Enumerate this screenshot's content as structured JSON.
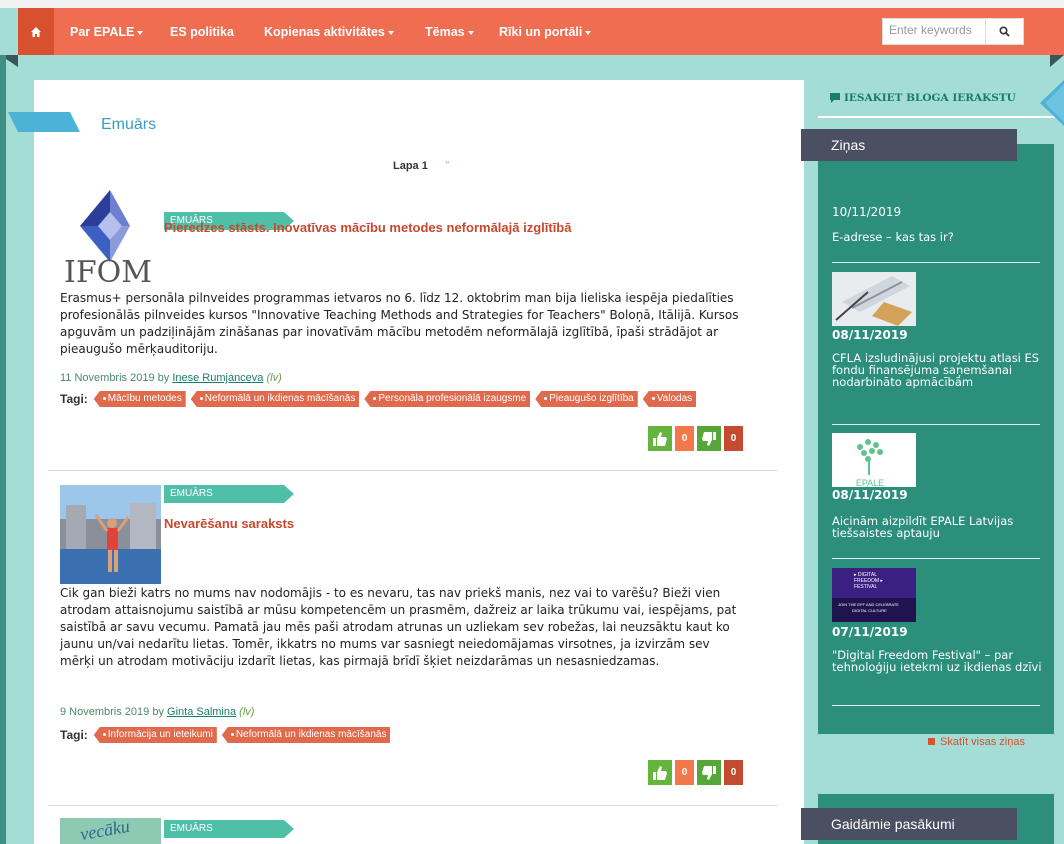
{
  "nav": {
    "items": [
      {
        "label": "Par EPALE",
        "dropdown": true
      },
      {
        "label": "ES politika",
        "dropdown": false
      },
      {
        "label": "Kopienas aktivitātes",
        "dropdown": true
      },
      {
        "label": "Tēmas",
        "dropdown": true
      },
      {
        "label": "Rīki un portāli",
        "dropdown": true
      }
    ],
    "search_placeholder": "Enter keywords"
  },
  "colors": {
    "nav": "#ef6d51",
    "accent_teal": "#2b8f7c",
    "title_red": "#c9482e",
    "background": "#a3ddd6"
  },
  "page": {
    "section_title": "Emuārs",
    "pager_label": "Lapa 1",
    "pager_arrow": "\""
  },
  "posts": [
    {
      "category": "EMUĀRS",
      "title": "Pieredzes stāsts. Inovatīvas mācību metodes neformālajā izglītībā",
      "logo_text": "IFOM",
      "excerpt": "Erasmus+ personāla pilnveides programmas ietvaros no 6. līdz 12. oktobrim man bija lieliska iespēja piedalīties profesionālās pilnveides kursos \"Innovative Teaching Methods and Strategies for Teachers\" Boloņā, Itālijā. Kursos apguvām un padziļinājām zināšanas par inovatīvām mācību metodēm neformālajā izglītībā, īpaši strādājot ar pieaugušo mērķauditoriju.",
      "date": "11 Novembris 2019 by",
      "author": "Inese Rumjanceva",
      "lang": "(lv)",
      "tags_label": "Tagi:",
      "tags": [
        "Mācību metodes",
        "Neformālā un ikdienas mācīšanās",
        "Personāla profesionālā izaugsme",
        "Pieaugušo izglītība",
        "Valodas"
      ],
      "likes": "0",
      "dislikes": "0"
    },
    {
      "category": "EMUĀRS",
      "title": "Nevarēšanu saraksts",
      "excerpt": "Cik gan bieži katrs no mums nav nodomājis - to es nevaru, tas nav priekš manis, nez vai to varēšu? Bieži vien atrodam attaisnojumu saistībā ar mūsu kompetencēm un prasmēm, dažreiz ar laika trūkumu vai, iespējams, pat saistībā ar savu vecumu. Pamatā jau mēs paši atrodam atrunas un uzliekam sev robežas, lai neuzsāktu kaut ko jaunu un/vai nedarītu lietas. Tomēr, ikkatrs no mums var sasniegt neiedomājamas virsotnes, ja izvirzām sev mērķi un atrodam motivāciju izdarīt lietas, kas pirmajā brīdī šķiet neizdarāmas un nesasniedzamas.",
      "date": "9 Novembris 2019 by",
      "author": "Ginta Salmina",
      "lang": "(lv)",
      "tags_label": "Tagi:",
      "tags": [
        "Informācija un ieteikumi",
        "Neformālā un ikdienas mācīšanās"
      ],
      "likes": "0",
      "dislikes": "0"
    },
    {
      "category": "EMUĀRS",
      "thumb_text": "vecāku"
    }
  ],
  "sidebar": {
    "propose_label": "IESAKIET BLOGA IERAKSTU",
    "news_title": "Ziņas",
    "news": [
      {
        "date": "10/11/2019",
        "text": "E-adrese – kas tas ir?"
      },
      {
        "date": "08/11/2019",
        "text": "CFLA izsludinājusi projektu atlasi ES fondu finansējuma saņemšanai nodarbināto apmācībām"
      },
      {
        "date": "08/11/2019",
        "text": "Aicinām aizpildīt EPALE Latvijas tiešsaistes aptauju",
        "img_text": "EPALE"
      },
      {
        "date": "07/11/2019",
        "text": "\"Digital Freedom Festival\" – par tehnoloģiju ietekmi uz ikdienas dzīvi",
        "img_text": [
          "▸ DIGITAL",
          "FREEDOM ▸",
          "FESTIVAL",
          "JOIN THE EPF AND CELEBRATE",
          "DIGITAL CULTURE"
        ]
      }
    ],
    "see_all_label": "Skatīt visas ziņas",
    "events_title": "Gaidāmie pasākumi"
  }
}
